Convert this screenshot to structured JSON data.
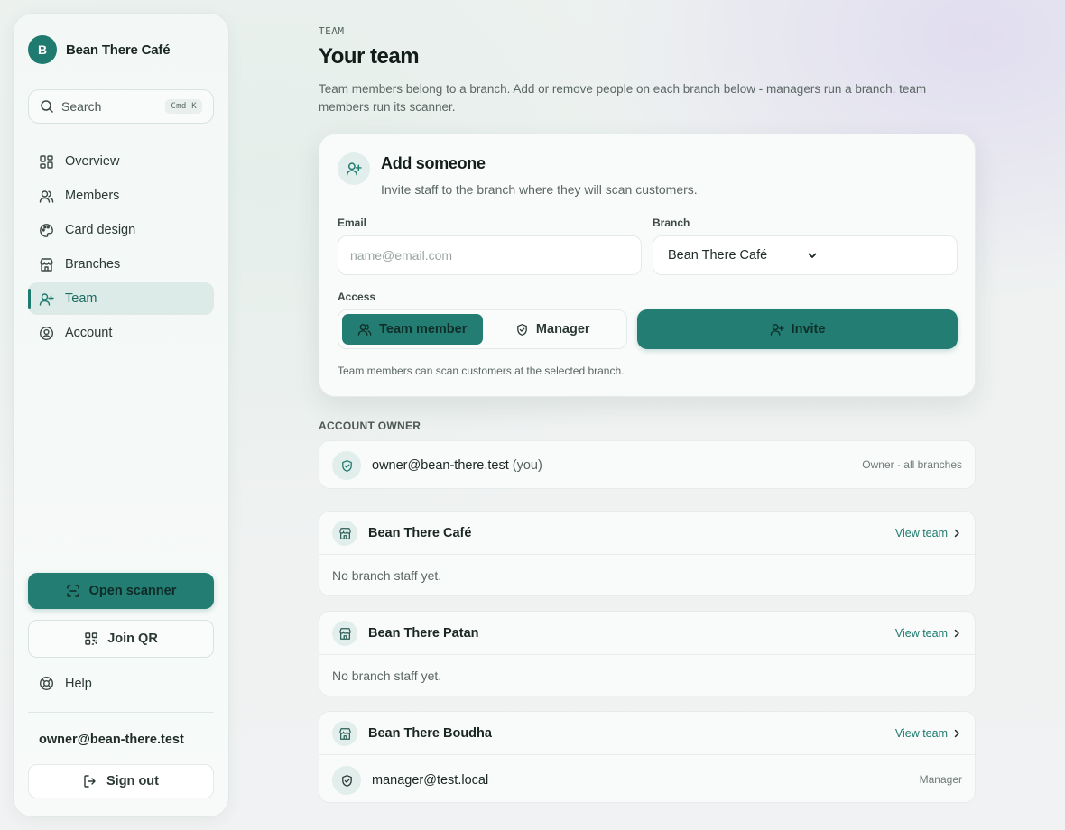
{
  "sidebar": {
    "brand_initial": "B",
    "brand_name": "Bean There Café",
    "search_label": "Search",
    "search_shortcut": "Cmd K",
    "nav": [
      {
        "label": "Overview",
        "icon": "grid-icon"
      },
      {
        "label": "Members",
        "icon": "users-icon"
      },
      {
        "label": "Card design",
        "icon": "palette-icon"
      },
      {
        "label": "Branches",
        "icon": "store-icon"
      },
      {
        "label": "Team",
        "icon": "user-plus-icon",
        "active": true
      },
      {
        "label": "Account",
        "icon": "user-circle-icon"
      }
    ],
    "open_scanner": "Open scanner",
    "join_qr": "Join QR",
    "help": "Help",
    "user_email": "owner@bean-there.test",
    "sign_out": "Sign out"
  },
  "header": {
    "eyebrow": "TEAM",
    "title": "Your team",
    "description": "Team members belong to a branch. Add or remove people on each branch below - managers run a branch, team members run its scanner."
  },
  "add_form": {
    "title": "Add someone",
    "subtitle": "Invite staff to the branch where they will scan customers.",
    "email_label": "Email",
    "email_placeholder": "name@email.com",
    "email_value": "",
    "branch_label": "Branch",
    "branch_selected": "Bean There Café",
    "access_label": "Access",
    "access_options": [
      {
        "label": "Team member",
        "selected": true
      },
      {
        "label": "Manager",
        "selected": false
      }
    ],
    "invite_label": "Invite",
    "hint": "Team members can scan customers at the selected branch."
  },
  "account_owner": {
    "section_label": "ACCOUNT OWNER",
    "email": "owner@bean-there.test",
    "you_tag": "(you)",
    "role": "Owner · all branches"
  },
  "branches": [
    {
      "name": "Bean There Café",
      "view_team": "View team",
      "empty_text": "No branch staff yet."
    },
    {
      "name": "Bean There Patan",
      "view_team": "View team",
      "empty_text": "No branch staff yet."
    },
    {
      "name": "Bean There Boudha",
      "view_team": "View team",
      "staff": [
        {
          "email": "manager@test.local",
          "role": "Manager"
        }
      ]
    }
  ],
  "colors": {
    "accent": "#237d72",
    "accent_light": "#dcebe7",
    "text_primary": "#1a2622",
    "text_muted": "#5b6764"
  }
}
